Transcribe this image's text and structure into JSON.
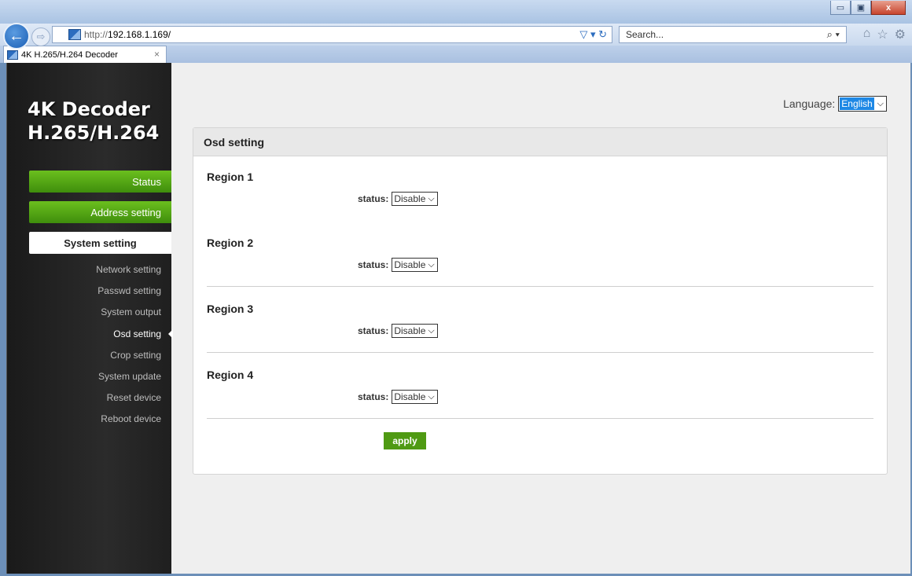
{
  "browser": {
    "url_protocol": "http://",
    "url_host": "192.168.1.169/",
    "search_placeholder": "Search...",
    "tab_title": "4K H.265/H.264 Decoder",
    "tab_close": "×",
    "back_glyph": "←",
    "forward_glyph": "⇨",
    "win_min": "▭",
    "win_max": "▣",
    "win_close": "x",
    "addr_tools": "▽ ▾ ↻",
    "search_glyph": "⌕ ▾",
    "toolbar_icons": [
      "⌂",
      "☆",
      "⚙"
    ]
  },
  "sidebar": {
    "brand_line1": "4K Decoder",
    "brand_line2": "H.265/H.264",
    "menu": [
      {
        "label": "Status"
      },
      {
        "label": "Address setting"
      },
      {
        "label": "System setting",
        "active": true
      }
    ],
    "submenu": [
      {
        "label": "Network setting"
      },
      {
        "label": "Passwd setting"
      },
      {
        "label": "System output"
      },
      {
        "label": "Osd setting",
        "active": true
      },
      {
        "label": "Crop setting"
      },
      {
        "label": "System update"
      },
      {
        "label": "Reset device"
      },
      {
        "label": "Reboot device"
      }
    ]
  },
  "language": {
    "label": "Language:",
    "selected": "English"
  },
  "panel": {
    "title": "Osd setting",
    "status_label": "status:",
    "regions": [
      {
        "title": "Region 1",
        "status": "Disable"
      },
      {
        "title": "Region 2",
        "status": "Disable"
      },
      {
        "title": "Region 3",
        "status": "Disable"
      },
      {
        "title": "Region 4",
        "status": "Disable"
      }
    ],
    "apply_label": "apply"
  }
}
